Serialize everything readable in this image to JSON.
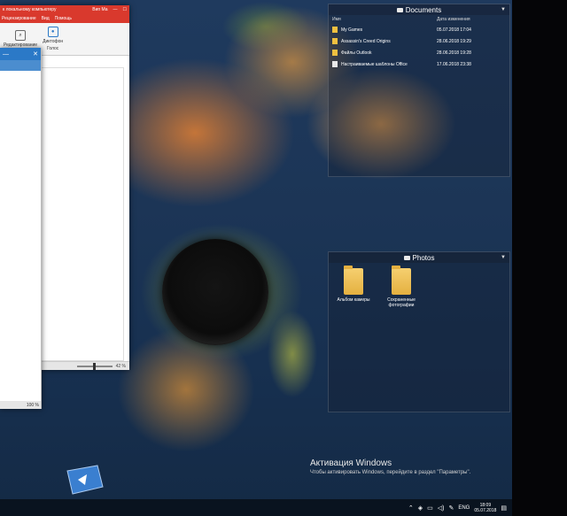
{
  "word_window": {
    "title_left": "к локальному компьютеру",
    "title_right": "Вип Ма",
    "tab_review": "Рецензирование",
    "tab_view": "Вид",
    "tab_help": "Помощь",
    "tool_dictation": "Диктофон",
    "tool_editor": "Редактирование",
    "group_voice": "Голос",
    "zoom": "42 %"
  },
  "small_window": {
    "zoom": "100 %"
  },
  "fences": {
    "documents": {
      "title": "Documents",
      "col_name": "Имя",
      "col_date": "Дата изменения",
      "rows": [
        {
          "name": "My Games",
          "date": "05.07.2018 17:04",
          "kind": "folder"
        },
        {
          "name": "Assassin's Creed Origins",
          "date": "28.06.2018 19:29",
          "kind": "folder"
        },
        {
          "name": "Файлы Outlook",
          "date": "28.06.2018 19:28",
          "kind": "folder"
        },
        {
          "name": "Настраиваемые шаблоны Office",
          "date": "17.06.2018 23:38",
          "kind": "folder"
        }
      ]
    },
    "photos": {
      "title": "Photos",
      "items": [
        {
          "label": "Альбом камеры"
        },
        {
          "label": "Сохраненные фотографии"
        }
      ]
    }
  },
  "activation": {
    "title": "Активация Windows",
    "subtitle": "Чтобы активировать Windows, перейдите в раздел \"Параметры\"."
  },
  "taskbar": {
    "language": "ENG",
    "time": "18:09",
    "date": "05.07.2018"
  },
  "colors": {
    "word_accent": "#d9392d",
    "window_accent": "#2b79c7",
    "folder": "#f0c040"
  }
}
